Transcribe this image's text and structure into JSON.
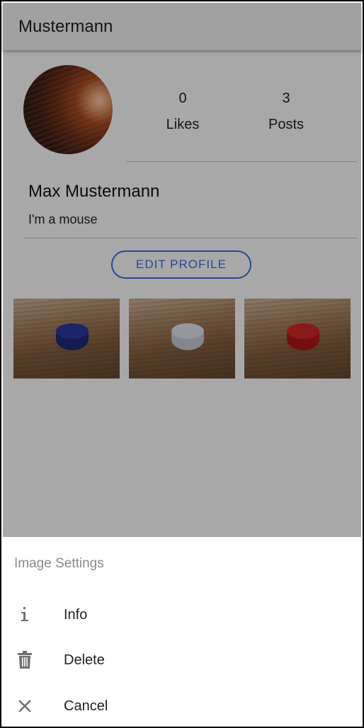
{
  "appbar": {
    "title": "Mustermann"
  },
  "profile": {
    "likes_count": "0",
    "likes_label": "Likes",
    "posts_count": "3",
    "posts_label": "Posts",
    "name": "Max Mustermann",
    "bio": "I'm a mouse",
    "edit_button": "EDIT PROFILE"
  },
  "posts": [
    {
      "thumbnail": "blue-cap-photo"
    },
    {
      "thumbnail": "white-cap-photo"
    },
    {
      "thumbnail": "red-cap-photo"
    }
  ],
  "sheet": {
    "title": "Image Settings",
    "items": [
      {
        "icon": "info-icon",
        "label": "Info"
      },
      {
        "icon": "trash-icon",
        "label": "Delete"
      },
      {
        "icon": "close-icon",
        "label": "Cancel"
      }
    ]
  },
  "colors": {
    "accent": "#3f6ee0",
    "appbar": "#f5f5f5",
    "scrim": "rgba(0,0,0,0.34)",
    "sheet_title": "#8a8a8a",
    "icon": "#6f6f6f"
  }
}
